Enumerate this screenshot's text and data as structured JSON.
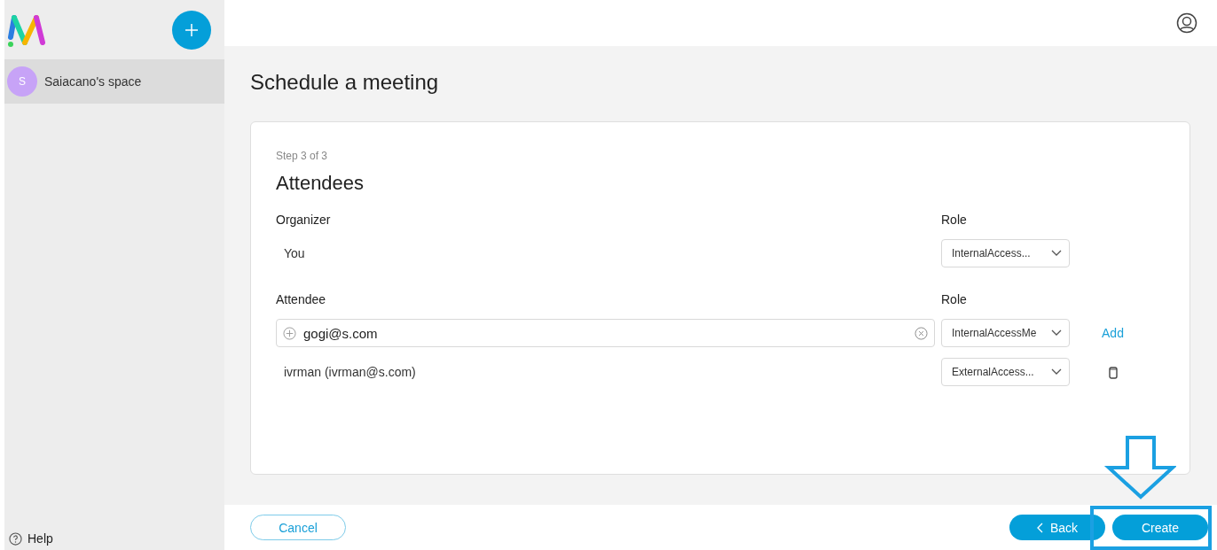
{
  "sidebar": {
    "spaces": [
      {
        "initial": "S",
        "name": "Saiacano's space",
        "selected": true
      }
    ],
    "help": "Help"
  },
  "page": {
    "title": "Schedule a meeting"
  },
  "form": {
    "step": "Step 3 of 3",
    "title": "Attendees",
    "organizer_label": "Organizer",
    "organizer_role_label": "Role",
    "organizer": {
      "name": "You",
      "role": "InternalAccess..."
    },
    "attendee_label": "Attendee",
    "attendee_role_label": "Role",
    "new_attendee": {
      "value": "gogi@s.com",
      "role": "InternalAccessMe",
      "add": "Add"
    },
    "attendees": [
      {
        "name": "ivrman (ivrman@s.com)",
        "role": "ExternalAccess..."
      }
    ]
  },
  "footer": {
    "cancel": "Cancel",
    "back": "Back",
    "create": "Create"
  }
}
